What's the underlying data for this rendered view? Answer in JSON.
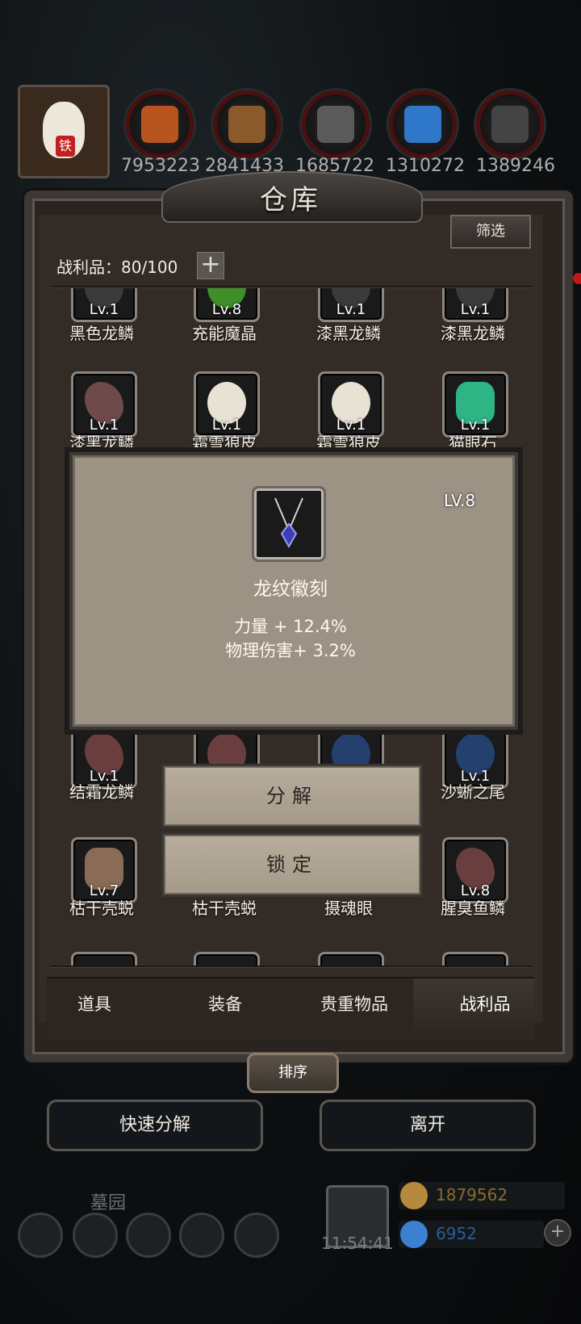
{
  "resources": [
    "7953223",
    "2841433",
    "1685722",
    "1310272",
    "1389246"
  ],
  "avatar_badge": "铁",
  "window": {
    "title": "仓库",
    "filter_label": "筛选"
  },
  "loot": {
    "label": "战利品：80/100",
    "plus": "+"
  },
  "items": [
    {
      "name": "黑色龙鳞",
      "level": "Lv.1",
      "art": "#3a3a3a"
    },
    {
      "name": "充能魔晶",
      "level": "Lv.8",
      "art": "#3e8f2a"
    },
    {
      "name": "漆黑龙鳞",
      "level": "Lv.1",
      "art": "#3a3a3a"
    },
    {
      "name": "漆黑龙鳞",
      "level": "Lv.1",
      "art": "#3a3a3a"
    },
    {
      "name": "漆黑龙鳞",
      "level": "Lv.1",
      "art": "#6e4a4a"
    },
    {
      "name": "霜雪狼皮",
      "level": "Lv.1",
      "art": "#e8e2d4"
    },
    {
      "name": "霜雪狼皮",
      "level": "Lv.1",
      "art": "#e8e2d4"
    },
    {
      "name": "猫眼石",
      "level": "Lv.1",
      "art": "#2fb585"
    },
    {
      "name": "结霜龙鳞",
      "level": "Lv.1",
      "art": "#6a3e3e"
    },
    {
      "name": "沙蜥之尾",
      "level": "Lv.1",
      "art": "#23406e"
    },
    {
      "name": "枯干壳蜕",
      "level": "Lv.7",
      "art": "#8a6b55"
    },
    {
      "name": "枯干壳蜕",
      "level": "",
      "art": "#8a6b55"
    },
    {
      "name": "摄魂眼",
      "level": "",
      "art": "#2a2a2a"
    },
    {
      "name": "腥臭鱼鳞",
      "level": "Lv.8",
      "art": "#6a3e3e"
    }
  ],
  "popup": {
    "level": "LV.8",
    "name": "龙纹徽刻",
    "stats": [
      "力量 + 12.4%",
      "物理伤害+ 3.2%"
    ],
    "decompose": "分解",
    "lock": "锁定"
  },
  "tabs": [
    "道具",
    "装备",
    "贵重物品",
    "战利品"
  ],
  "active_tab": "战利品",
  "sort_label": "排序",
  "quick_decompose": "快速分解",
  "leave": "离开",
  "bottom": {
    "location": "墓园",
    "time": "11:54:41",
    "gold": "1879562",
    "gems": "6952"
  },
  "colors": {
    "accent_gold": "#b58a3c",
    "gem_blue": "#3d7fd0",
    "panel": "#332b25"
  }
}
